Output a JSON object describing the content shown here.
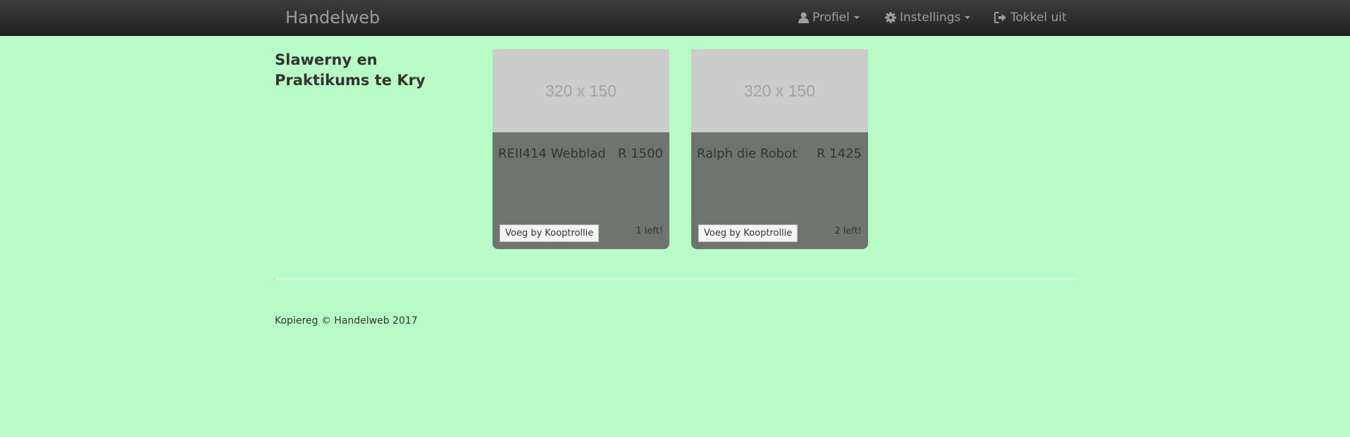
{
  "navbar": {
    "brand": "Handelweb",
    "profile_label": "Profiel",
    "profile_icon": "user-icon",
    "settings_label": "Instellings",
    "settings_icon": "gear-icon",
    "logout_label": "Tokkel uit",
    "logout_icon": "log-out-icon"
  },
  "sidebar": {
    "heading": "Slawerny en Praktikums te Kry"
  },
  "products": [
    {
      "image_placeholder": "320 x 150",
      "title": "REII414 Webblad",
      "price": "R 1500",
      "button_label": "Voeg by Kooptrollie",
      "stock": "1 left!"
    },
    {
      "image_placeholder": "320 x 150",
      "title": "Ralph die Robot",
      "price": "R 1425",
      "button_label": "Voeg by Kooptrollie",
      "stock": "2 left!"
    }
  ],
  "footer": {
    "copyright": "Kopiereg © Handelweb 2017"
  },
  "colors": {
    "page_background": "#b9fbc6",
    "navbar_background": "#222222",
    "card_background": "#6f746f",
    "image_placeholder_background": "#cccccc"
  }
}
